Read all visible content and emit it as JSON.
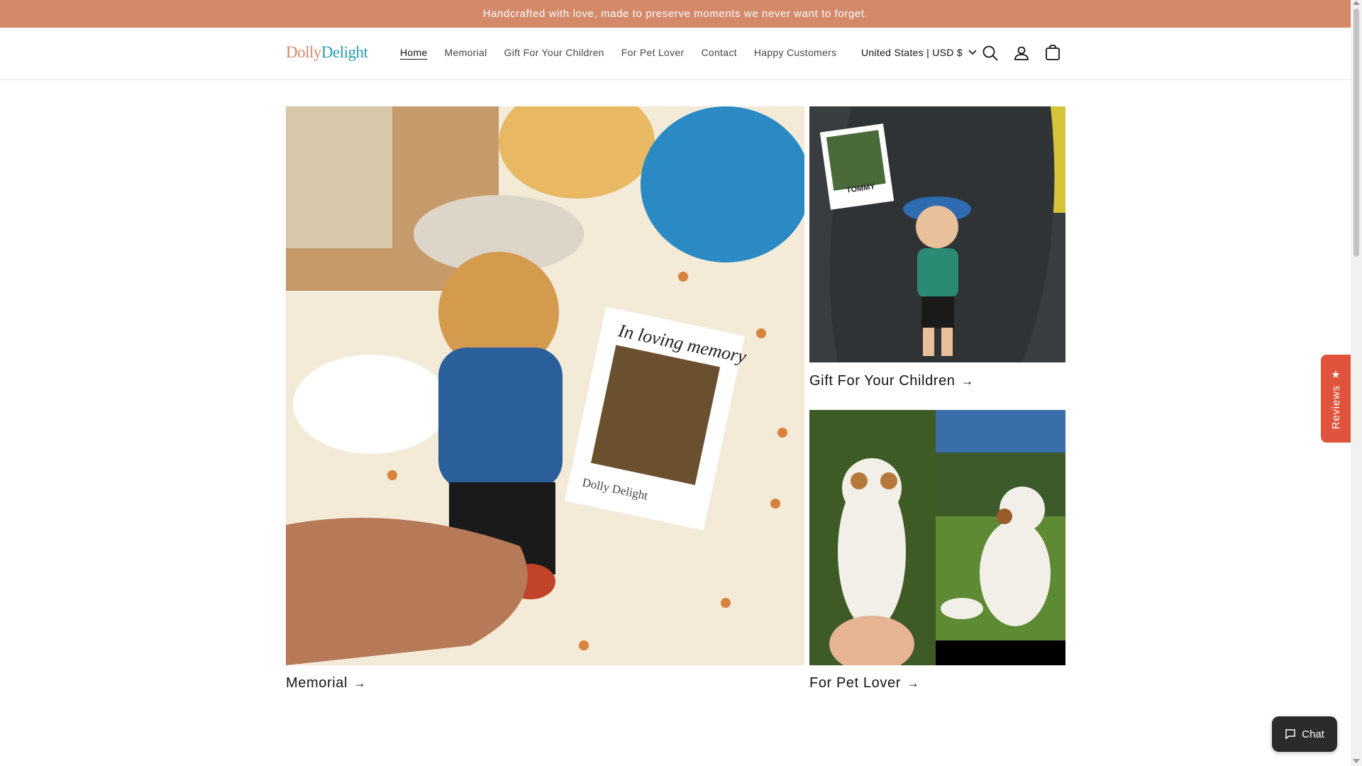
{
  "announcement": {
    "text": "Handcrafted with love, made to preserve moments we never want to forget."
  },
  "header": {
    "logo_part1": "Dolly",
    "logo_part2": "Delight",
    "nav": [
      {
        "label": "Home",
        "active": true
      },
      {
        "label": "Memorial"
      },
      {
        "label": "Gift For Your Children"
      },
      {
        "label": "For Pet Lover"
      },
      {
        "label": "Contact"
      },
      {
        "label": "Happy Customers"
      }
    ],
    "locale": "United States | USD $",
    "icons": [
      "search-icon",
      "account-icon",
      "cart-icon"
    ]
  },
  "collections": [
    {
      "title": "Memorial",
      "image_photo_text_1": "In loving memory",
      "image_photo_text_2": "Dolly Delight"
    },
    {
      "title": "Gift For Your Children",
      "image_photo_text": "TOMMY"
    },
    {
      "title": "For Pet Lover"
    }
  ],
  "widgets": {
    "reviews_label": "Reviews",
    "chat_label": "Chat"
  },
  "colors": {
    "brand_peach": "#d4896a",
    "brand_teal": "#2a9bb0",
    "reviews_red": "#e0533c",
    "chat_dark": "#2b2b2b"
  }
}
